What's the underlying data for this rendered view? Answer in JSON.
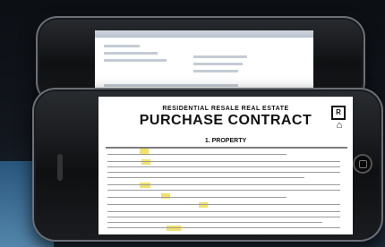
{
  "document": {
    "header_small": "RESIDENTIAL RESALE REAL ESTATE",
    "title": "PURCHASE CONTRACT",
    "section_title": "1. PROPERTY"
  },
  "icons": {
    "realtor": "realtor-r-icon",
    "equal_housing": "equal-housing-icon",
    "home_button": "home-button-icon"
  }
}
